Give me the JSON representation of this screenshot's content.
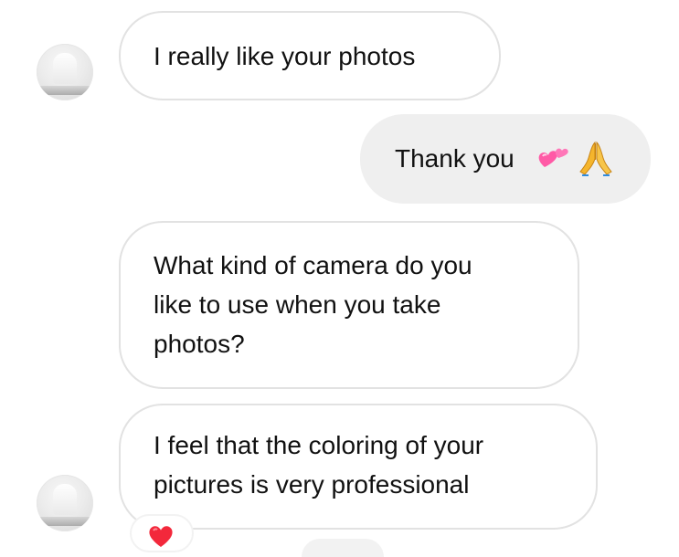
{
  "messages": [
    {
      "direction": "incoming",
      "text": "I really like your photos"
    },
    {
      "direction": "outgoing",
      "text": "Thank you",
      "emojis": [
        "two-hearts-emoji",
        "folded-hands-emoji"
      ]
    },
    {
      "direction": "incoming",
      "text": "What kind of camera do you\nlike to use when you take\nphotos?"
    },
    {
      "direction": "incoming",
      "text": "I feel that the coloring of your\npictures is very professional",
      "reaction": "red-heart-emoji"
    }
  ],
  "avatars": [
    {
      "name": "sender-avatar"
    },
    {
      "name": "sender-avatar"
    }
  ],
  "colors": {
    "incoming_bubble_bg": "#ffffff",
    "incoming_bubble_border": "#e2e2e2",
    "outgoing_bubble_bg": "#efefef",
    "text": "#111111",
    "heart_pink": "#ff5aa6",
    "heart_red": "#f3283b",
    "hands_yellow": "#f5b52c"
  }
}
